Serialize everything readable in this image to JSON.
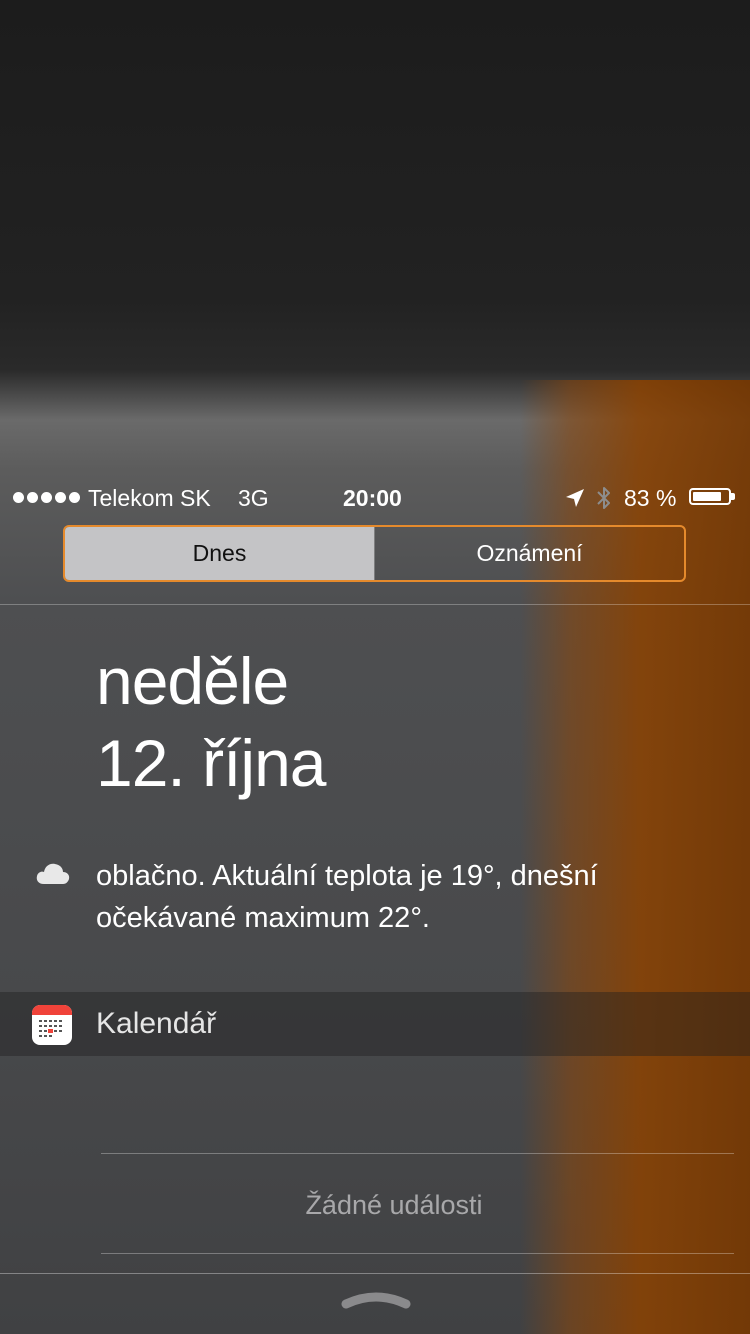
{
  "status_bar": {
    "carrier": "Telekom SK",
    "network": "3G",
    "time": "20:00",
    "battery_text": "83 %",
    "battery_level": 0.83,
    "signal_bars": 5,
    "icons": [
      "location-arrow-icon",
      "bluetooth-icon",
      "battery-icon"
    ]
  },
  "tabs": [
    {
      "label": "Dnes",
      "selected": true
    },
    {
      "label": "Oznámení",
      "selected": false
    }
  ],
  "today": {
    "weekday": "neděle",
    "date": "12. října"
  },
  "weather": {
    "icon": "cloud-icon",
    "summary": "oblačno. Aktuální teplota je 19°, dnešní očekávané maximum 22°."
  },
  "calendar": {
    "icon": "calendar-app-icon",
    "title": "Kalendář",
    "empty_message": "Žádné události"
  },
  "colors": {
    "accent": "#e58a2c",
    "selected_tab_bg": "#c4c4c6",
    "calendar_red": "#f0433a"
  }
}
